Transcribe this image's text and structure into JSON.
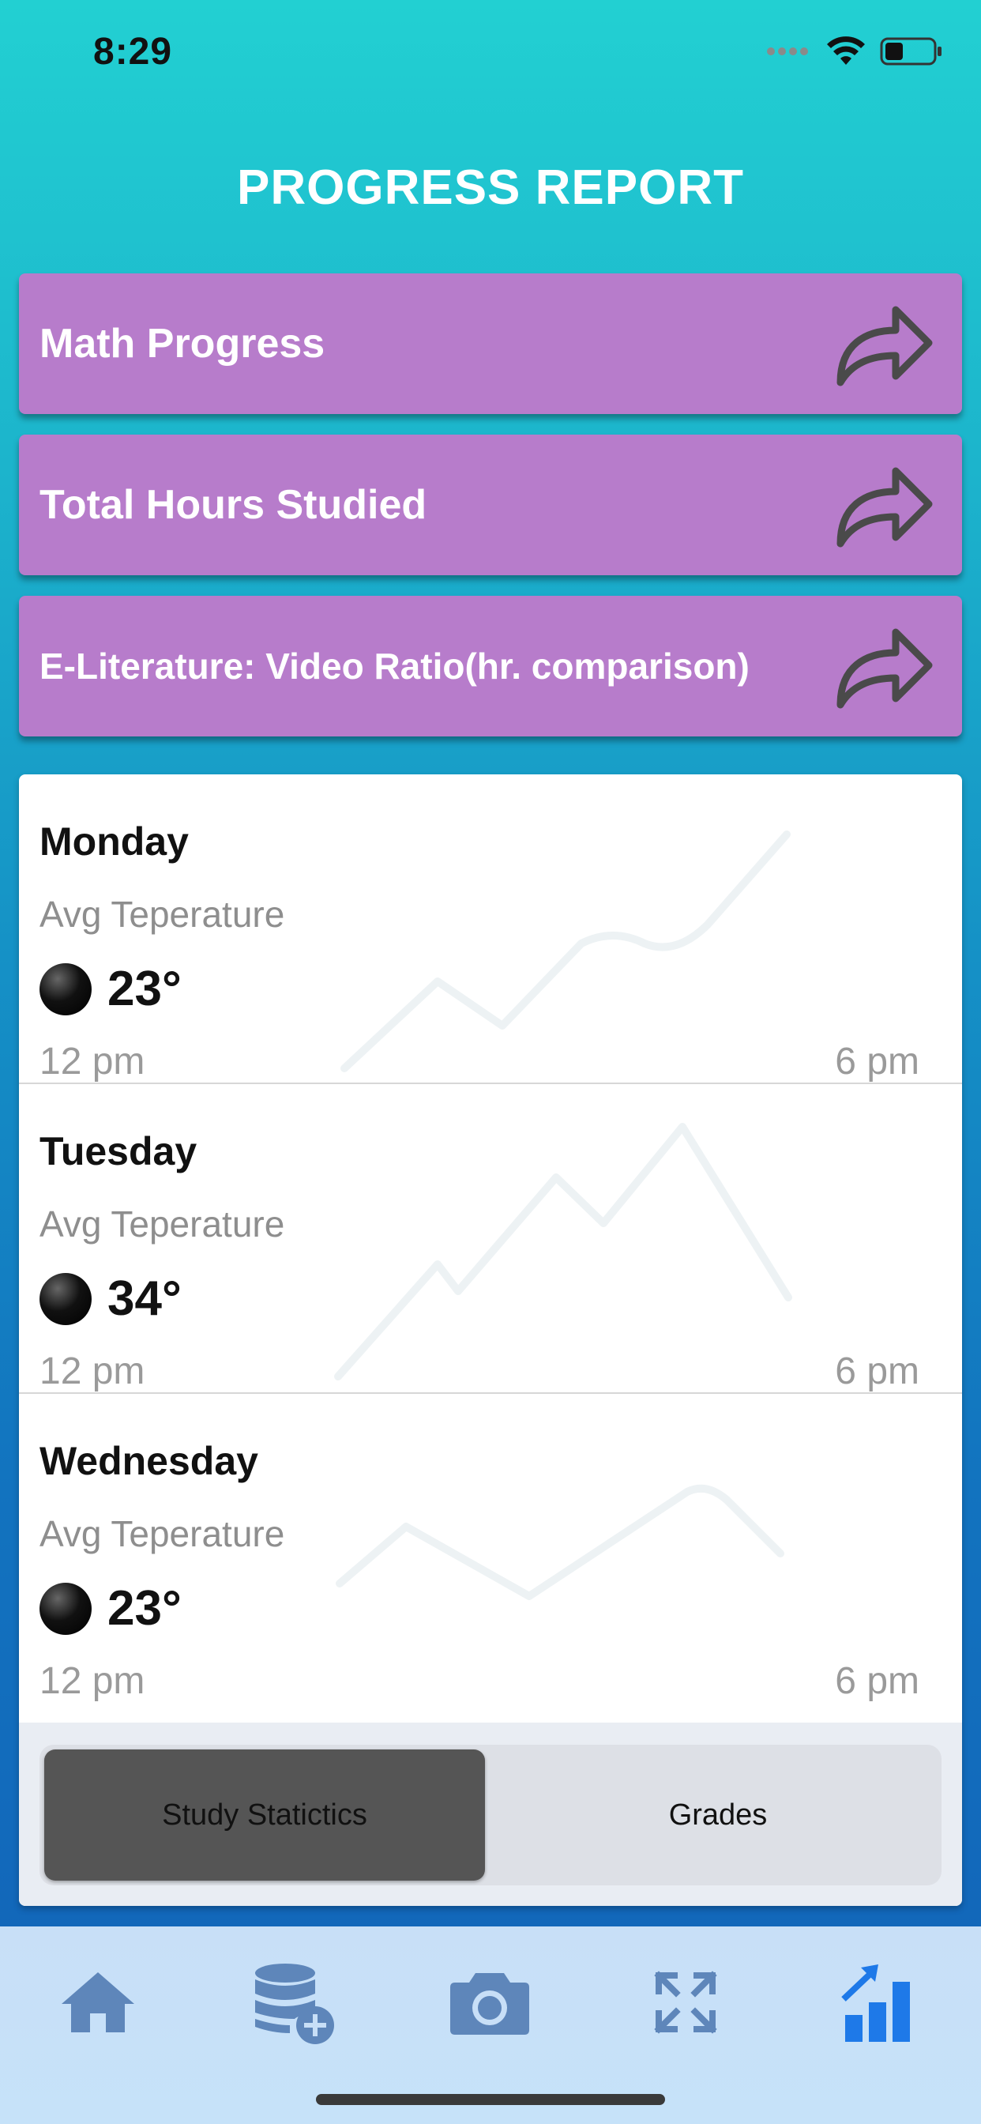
{
  "status_bar": {
    "time": "8:29"
  },
  "header": {
    "title": "PROGRESS REPORT"
  },
  "report_links": [
    {
      "label": "Math Progress",
      "icon": "share-arrow-icon"
    },
    {
      "label": "Total Hours Studied",
      "icon": "share-arrow-icon"
    },
    {
      "label": "E-Literature: Video Ratio(hr. comparison)",
      "icon": "share-arrow-icon"
    }
  ],
  "days": [
    {
      "name": "Monday",
      "metric_label": "Avg Teperature",
      "temperature": "23°",
      "start_time": "12 pm",
      "end_time": "6 pm"
    },
    {
      "name": "Tuesday",
      "metric_label": "Avg Teperature",
      "temperature": "34°",
      "start_time": "12 pm",
      "end_time": "6 pm"
    },
    {
      "name": "Wednesday",
      "metric_label": "Avg Teperature",
      "temperature": "23°",
      "start_time": "12 pm",
      "end_time": "6 pm"
    }
  ],
  "segmented_control": {
    "options": [
      "Study Statictics",
      "Grades"
    ],
    "selected": "Study Statictics"
  },
  "tab_bar": {
    "items": [
      "home-icon",
      "database-add-icon",
      "camera-icon",
      "expand-icon",
      "chart-growth-icon"
    ],
    "active": "chart-growth-icon"
  },
  "colors": {
    "card_purple": "#b77ccb",
    "tab_icon": "#5e86ba",
    "tab_icon_active": "#1e79e8",
    "segment_active": "#555555"
  }
}
